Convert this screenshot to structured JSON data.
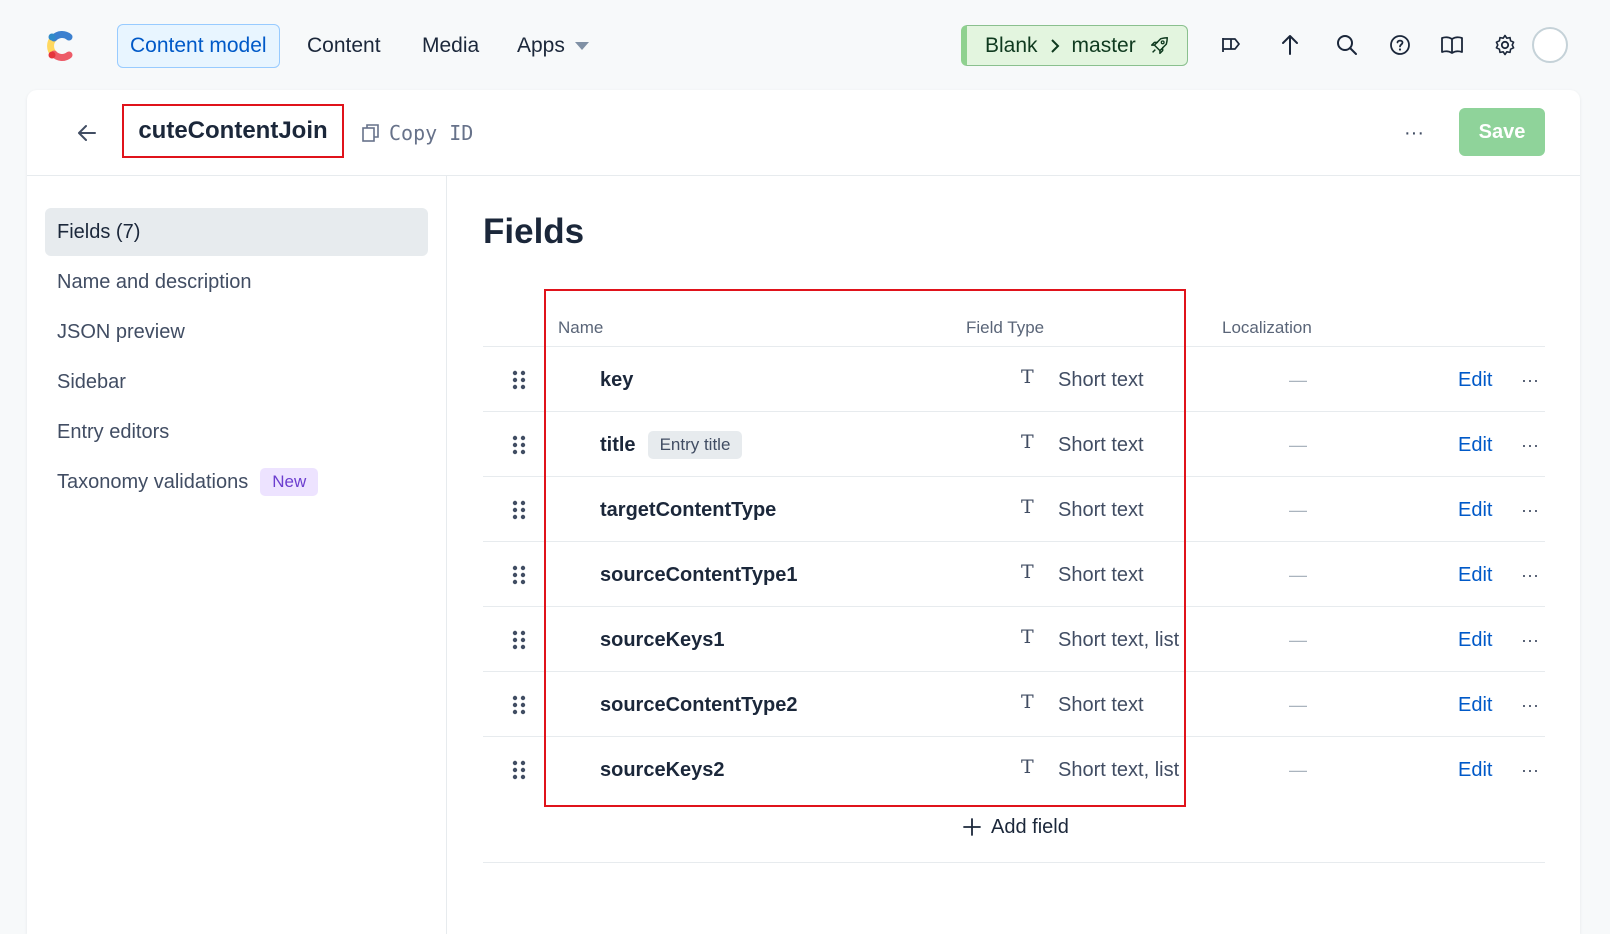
{
  "nav": {
    "tabs": [
      {
        "label": "Content model",
        "active": true
      },
      {
        "label": "Content",
        "active": false
      },
      {
        "label": "Media",
        "active": false
      },
      {
        "label": "Apps",
        "active": false
      }
    ],
    "environment": {
      "space": "Blank",
      "env": "master"
    },
    "icons": [
      "announcement-icon",
      "upload-arrow-icon",
      "search-icon",
      "help-icon",
      "docs-book-icon",
      "settings-gear-icon",
      "user-avatar"
    ]
  },
  "header": {
    "title": "cuteContentJoin",
    "copy_id_label": "Copy ID",
    "more_label": "···",
    "save_label": "Save"
  },
  "sidebar": {
    "items": [
      {
        "label": "Fields (7)",
        "active": true
      },
      {
        "label": "Name and description",
        "active": false
      },
      {
        "label": "JSON preview",
        "active": false
      },
      {
        "label": "Sidebar",
        "active": false
      },
      {
        "label": "Entry editors",
        "active": false
      },
      {
        "label": "Taxonomy validations",
        "active": false,
        "badge": "New"
      }
    ]
  },
  "main": {
    "title": "Fields",
    "columns": {
      "name": "Name",
      "field_type": "Field Type",
      "localization": "Localization"
    },
    "fields": [
      {
        "name": "key",
        "badge": "",
        "type": "Short text",
        "localization": "—",
        "edit": "Edit"
      },
      {
        "name": "title",
        "badge": "Entry title",
        "type": "Short text",
        "localization": "—",
        "edit": "Edit"
      },
      {
        "name": "targetContentType",
        "badge": "",
        "type": "Short text",
        "localization": "—",
        "edit": "Edit"
      },
      {
        "name": "sourceContentType1",
        "badge": "",
        "type": "Short text",
        "localization": "—",
        "edit": "Edit"
      },
      {
        "name": "sourceKeys1",
        "badge": "",
        "type": "Short text, list",
        "localization": "—",
        "edit": "Edit"
      },
      {
        "name": "sourceContentType2",
        "badge": "",
        "type": "Short text",
        "localization": "—",
        "edit": "Edit"
      },
      {
        "name": "sourceKeys2",
        "badge": "",
        "type": "Short text, list",
        "localization": "—",
        "edit": "Edit"
      }
    ],
    "type_icon_glyph": "T",
    "row_more_label": "···",
    "add_field_label": "Add field"
  },
  "colors": {
    "accent_blue": "#0059c8",
    "save_green": "#8fd39a",
    "highlight_red": "#e0131b",
    "env_green_bg": "#e3f5df",
    "new_badge_purple": "#6c3ecf"
  }
}
